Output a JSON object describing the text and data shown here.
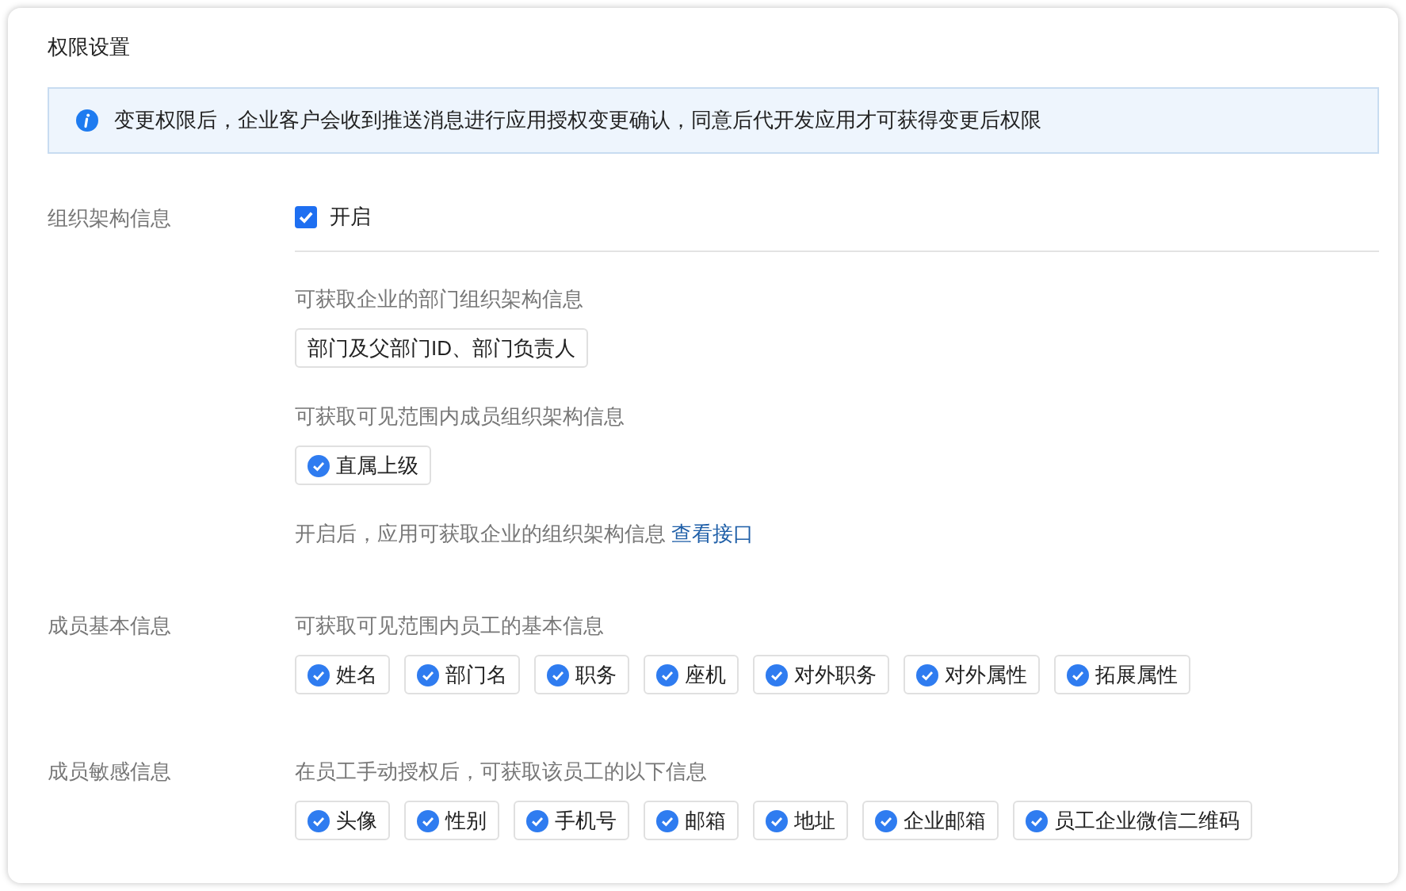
{
  "title": "权限设置",
  "notice": "变更权限后，企业客户会收到推送消息进行应用授权变更确认，同意后代开发应用才可获得变更后权限",
  "sections": [
    {
      "label": "组织架构信息",
      "toggle": {
        "label": "开启",
        "checked": true
      },
      "groups": [
        {
          "description": "可获取企业的部门组织架构信息",
          "tags": [
            {
              "label": "部门及父部门ID、部门负责人",
              "checked": false
            }
          ]
        },
        {
          "description": "可获取可见范围内成员组织架构信息",
          "tags": [
            {
              "label": "直属上级",
              "checked": true
            }
          ]
        }
      ],
      "note": {
        "text": "开启后，应用可获取企业的组织架构信息",
        "link": "查看接口"
      }
    },
    {
      "label": "成员基本信息",
      "groups": [
        {
          "description": "可获取可见范围内员工的基本信息",
          "tags": [
            {
              "label": "姓名",
              "checked": true
            },
            {
              "label": "部门名",
              "checked": true
            },
            {
              "label": "职务",
              "checked": true
            },
            {
              "label": "座机",
              "checked": true
            },
            {
              "label": "对外职务",
              "checked": true
            },
            {
              "label": "对外属性",
              "checked": true
            },
            {
              "label": "拓展属性",
              "checked": true
            }
          ]
        }
      ]
    },
    {
      "label": "成员敏感信息",
      "groups": [
        {
          "description": "在员工手动授权后，可获取该员工的以下信息",
          "tags": [
            {
              "label": "头像",
              "checked": true
            },
            {
              "label": "性别",
              "checked": true
            },
            {
              "label": "手机号",
              "checked": true
            },
            {
              "label": "邮箱",
              "checked": true
            },
            {
              "label": "地址",
              "checked": true
            },
            {
              "label": "企业邮箱",
              "checked": true
            },
            {
              "label": "员工企业微信二维码",
              "checked": true
            }
          ]
        }
      ]
    }
  ]
}
